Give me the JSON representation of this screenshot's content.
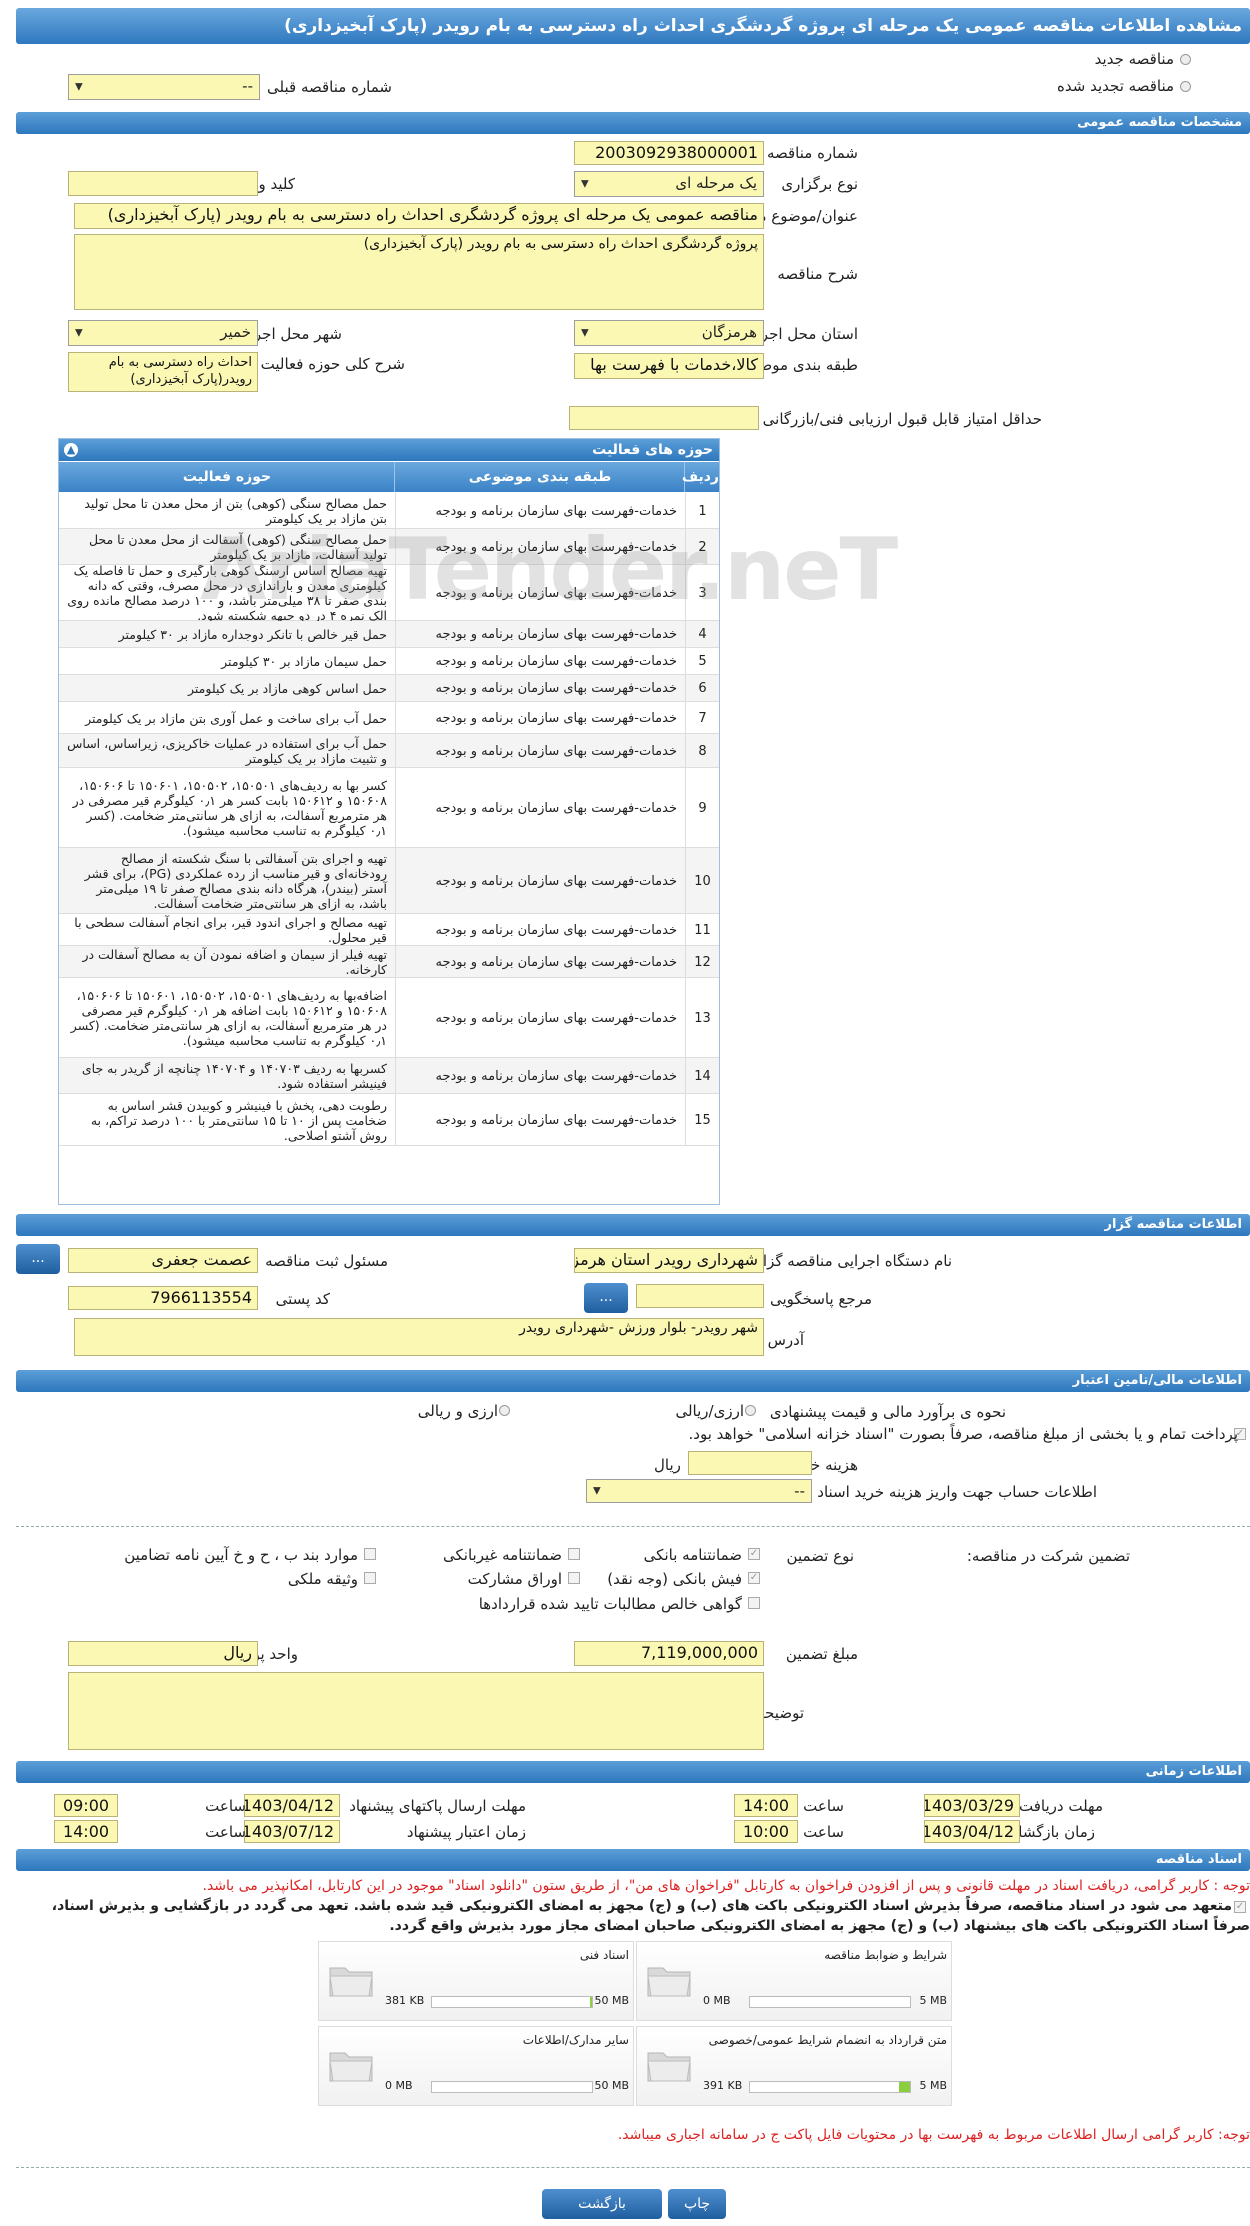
{
  "page_title": "مشاهده اطلاعات مناقصه عمومی یک مرحله ای پروژه گردشگری احداث راه دسترسی به بام رویدر (پارک آبخیزداری)",
  "top": {
    "radio_new": "مناقصه جدید",
    "radio_renewed": "مناقصه تجدید شده",
    "prev_number_label": "شماره مناقصه قبلی",
    "prev_number_value": "--"
  },
  "general": {
    "header": "مشخصات مناقصه عمومی",
    "number_label": "شماره مناقصه",
    "number_value": "2003092938000001",
    "type_label": "نوع برگزاری",
    "type_value": "یک مرحله ای",
    "keyword_label": "کلید واژه",
    "keyword_value": "",
    "subject_label": "عنوان/موضوع مناقصه",
    "subject_value": "مناقصه عمومی یک مرحله ای پروژه گردشگری احداث راه دسترسی به بام رویدر (پارک آبخیزداری)",
    "desc_label": "شرح مناقصه",
    "desc_value": "پروژه گردشگری احداث راه دسترسی به بام رویدر (پارک آبخیزداری)",
    "province_label": "استان محل اجرا",
    "province_value": "هرمزگان",
    "city_label": "شهر محل اجرا",
    "city_value": "خمیر",
    "category_label": "طبقه بندی موضوعی",
    "category_value": "کالا،خدمات با فهرست بها",
    "scope_label": "شرح کلی حوزه فعالیت",
    "scope_value": "احداث راه دسترسی به بام رویدر(پارک آبخیزداری)",
    "min_score_label": "حداقل امتیاز قابل قبول ارزیابی فنی/بازرگانی",
    "min_score_value": ""
  },
  "activities": {
    "title": "حوزه های فعالیت",
    "col_row": "ردیف",
    "col_category": "طبقه بندی موضوعی",
    "col_activity": "حوزه فعالیت",
    "rows": [
      {
        "n": "1",
        "cat": "خدمات-فهرست بهای سازمان برنامه و بودجه",
        "act": "حمل مصالح سنگی (کوهی) بتن از محل معدن تا محل تولید بتن مازاد بر یک کیلومتر"
      },
      {
        "n": "2",
        "cat": "خدمات-فهرست بهای سازمان برنامه و بودجه",
        "act": "حمل مصالح سنگی (کوهی) آسفالت از محل معدن تا محل تولید آسفالت، مازاد بر یک کیلومتر"
      },
      {
        "n": "3",
        "cat": "خدمات-فهرست بهای سازمان برنامه و بودجه",
        "act": "تهیه مصالح اساس آرسنگ کوهی بارگیری و حمل تا فاصله یک کیلومتری معدن و باراندازی در محل مصرف، وقتی که دانه بندی صفر تا ۳۸ میلی‌متر باشد، و ۱۰۰ درصد مصالح مانده روی الک نمره ۴ در دو جبهه شکسته شود."
      },
      {
        "n": "4",
        "cat": "خدمات-فهرست بهای سازمان برنامه و بودجه",
        "act": "حمل قیر خالص با تانکر دوجداره مازاد بر ۳۰ کیلومتر"
      },
      {
        "n": "5",
        "cat": "خدمات-فهرست بهای سازمان برنامه و بودجه",
        "act": "حمل سیمان مازاد بر ۳۰ کیلومتر"
      },
      {
        "n": "6",
        "cat": "خدمات-فهرست بهای سازمان برنامه و بودجه",
        "act": "حمل اساس کوهی مازاد بر یک کیلومتر"
      },
      {
        "n": "7",
        "cat": "خدمات-فهرست بهای سازمان برنامه و بودجه",
        "act": "حمل آب برای ساخت و عمل آوری بتن مازاد بر یک کیلومتر"
      },
      {
        "n": "8",
        "cat": "خدمات-فهرست بهای سازمان برنامه و بودجه",
        "act": "حمل آب برای استفاده در عملیات خاکریزی، زیراساس، اساس و تثبیت مازاد بر یک کیلومتر"
      },
      {
        "n": "9",
        "cat": "خدمات-فهرست بهای سازمان برنامه و بودجه",
        "act": "کسر بها به ردیف‌های ۱۵۰۵۰۱، ۱۵۰۵۰۲، ۱۵۰۶۰۱ تا ۱۵۰۶۰۶، ۱۵۰۶۰۸ و ۱۵۰۶۱۲ بابت کسر هر ۰٫۱ کیلوگرم قیر مصرفی در هر مترمربع آسفالت، به ازای هر سانتی‌متر ضخامت. (کسر ۰٫۱ کیلوگرم به تناسب محاسبه میشود)."
      },
      {
        "n": "10",
        "cat": "خدمات-فهرست بهای سازمان برنامه و بودجه",
        "act": "تهیه و اجرای بتن آسفالتی با سنگ شکسته از مصالح رودخانه‌ای و قیر مناسب از رده عملکردی (PG)، برای قشر آستر (بیندر)، هرگاه دانه بندی مصالح صفر تا ۱۹ میلی‌متر باشد، به ازای هر سانتی‌متر ضخامت آسفالت."
      },
      {
        "n": "11",
        "cat": "خدمات-فهرست بهای سازمان برنامه و بودجه",
        "act": "تهیه مصالح و اجرای اندود قیر، برای انجام آسفالت سطحی با قیر محلول."
      },
      {
        "n": "12",
        "cat": "خدمات-فهرست بهای سازمان برنامه و بودجه",
        "act": "تهیه فیلر از سیمان و اضافه نمودن آن به مصالح آسفالت در کارخانه."
      },
      {
        "n": "13",
        "cat": "خدمات-فهرست بهای سازمان برنامه و بودجه",
        "act": "اضافه‌بها به ردیف‌های ۱۵۰۵۰۱، ۱۵۰۵۰۲، ۱۵۰۶۰۱ تا ۱۵۰۶۰۶، ۱۵۰۶۰۸ و ۱۵۰۶۱۲ بابت اضافه هر ۰٫۱ کیلوگرم قیر مصرفی در هر مترمربع آسفالت، به ازای هر سانتی‌متر ضخامت. (کسر ۰٫۱ کیلوگرم به تناسب محاسبه میشود)."
      },
      {
        "n": "14",
        "cat": "خدمات-فهرست بهای سازمان برنامه و بودجه",
        "act": "کسربها به ردیف ۱۴۰۷۰۳ و ۱۴۰۷۰۴ چنانچه از گریدر به جای فینیشر استفاده شود."
      },
      {
        "n": "15",
        "cat": "خدمات-فهرست بهای سازمان برنامه و بودجه",
        "act": "رطوبت دهی، پخش با فینیشر و کوبیدن قشر اساس به ضخامت پس از ۱۰ تا ۱۵ سانتی‌متر با ۱۰۰ درصد تراکم، به روش آشتو اصلاحی."
      }
    ]
  },
  "organizer": {
    "header": "اطلاعات مناقصه گزار",
    "org_label": "نام دستگاه اجرایی مناقصه گزار",
    "org_value": "شهرداری رویدر استان هرمزگان",
    "resp_label": "مسئول ثبت مناقصه",
    "resp_value": "عصمت جعفری",
    "ref_label": "مرجع پاسخگویی",
    "ref_value": "",
    "postal_label": "کد پستی",
    "postal_value": "7966113554",
    "address_label": "آدرس",
    "address_value": "شهر رویدر- بلوار ورزش -شهرداری رویدر",
    "dots": "..."
  },
  "finance": {
    "header": "اطلاعات مالی/تامین اعتبار",
    "estimate_label": "نحوه ی برآورد مالی و قیمت پیشنهادی",
    "opt_rial_currency": "ارزی/ریالی",
    "opt_currency_rial": "ارزی و ریالی",
    "payment_text": "پرداخت تمام و یا بخشی از مبلغ مناقصه، صرفاً بصورت \"اسناد خزانه اسلامی\" خواهد بود.",
    "fee_label": "هزینه خرید اسناد",
    "fee_unit": "ریال",
    "account_label": "اطلاعات حساب جهت واریز هزینه خرید اسناد",
    "account_value": "--",
    "guarantee_title": "تضمین شرکت در مناقصه:",
    "guarantee_type": "نوع تضمین",
    "opt_bank_guarantee": "ضمانتنامه بانکی",
    "opt_nonbank": "ضمانتنامه غیربانکی",
    "opt_clause": "موارد بند ب ، ح و خ آیین نامه تضامین",
    "opt_check": "فیش بانکی (وجه نقد)",
    "opt_bonds": "اوراق مشارکت",
    "opt_property": "وثیقه ملکی",
    "opt_receivables": "گواهی خالص مطالبات تایید شده قراردادها",
    "amount_label": "مبلغ تضمین",
    "amount_value": "7,119,000,000",
    "currency_label": "واحد پول",
    "currency_value": "ریال",
    "notes_label": "توضیحات",
    "notes_value": ""
  },
  "timing": {
    "header": "اطلاعات زمانی",
    "doc_deadline_label": "مهلت دریافت اسناد",
    "doc_deadline_date": "1403/03/29",
    "doc_deadline_time": "14:00",
    "send_deadline_label": "مهلت ارسال پاکتهای پیشنهاد",
    "send_deadline_date": "1403/04/12",
    "send_deadline_time": "09:00",
    "open_label": "زمان بازگشایی پاکت ها",
    "open_date": "1403/04/12",
    "open_time": "10:00",
    "validity_label": "زمان اعتبار پیشنهاد",
    "validity_date": "1403/07/12",
    "validity_time": "14:00",
    "time_label": "ساعت"
  },
  "documents": {
    "header": "اسناد مناقصه",
    "notice_red": "توجه : کاربر گرامی، دریافت اسناد در مهلت قانونی و پس از افزودن فراخوان به کارتابل \"فراخوان های من\"، از طریق ستون \"دانلود اسناد\" موجود در این کارتابل، امکانپذیر می باشد.",
    "notice_bold1": "متعهد می شود در اسناد مناقصه، صرفاً بذیرش اسناد الکترونیکی باکت های (ب) و (ج) مجهز به امضای الکترونیکی قید شده باشد. تعهد می گردد در بازگشایی و بذیرش اسناد،",
    "notice_bold2": "صرفاً اسناد الکترونیکی باکت های بیشنهاد (ب) و (ج) مجهز به امضای الکترونیکی صاحبان امضای مجاز مورد بذیرش واقع گردد.",
    "items": [
      {
        "name": "شرایط و ضوابط مناقصه",
        "used": "0 MB",
        "max": "5 MB",
        "pct": 0
      },
      {
        "name": "اسناد فنی",
        "used": "381 KB",
        "max": "50 MB",
        "pct": 1
      },
      {
        "name": "متن قرارداد به انضمام شرایط عمومی/خصوصی",
        "used": "391 KB",
        "max": "5 MB",
        "pct": 7
      },
      {
        "name": "سایر مدارک/اطلاعات",
        "used": "0 MB",
        "max": "50 MB",
        "pct": 0
      }
    ],
    "notice_bottom": "توجه: کاربر گرامی ارسال اطلاعات مربوط به فهرست بها در محتویات فایل پاکت ج در سامانه اجباری میباشد."
  },
  "buttons": {
    "print": "چاپ",
    "back": "بازگشت"
  }
}
